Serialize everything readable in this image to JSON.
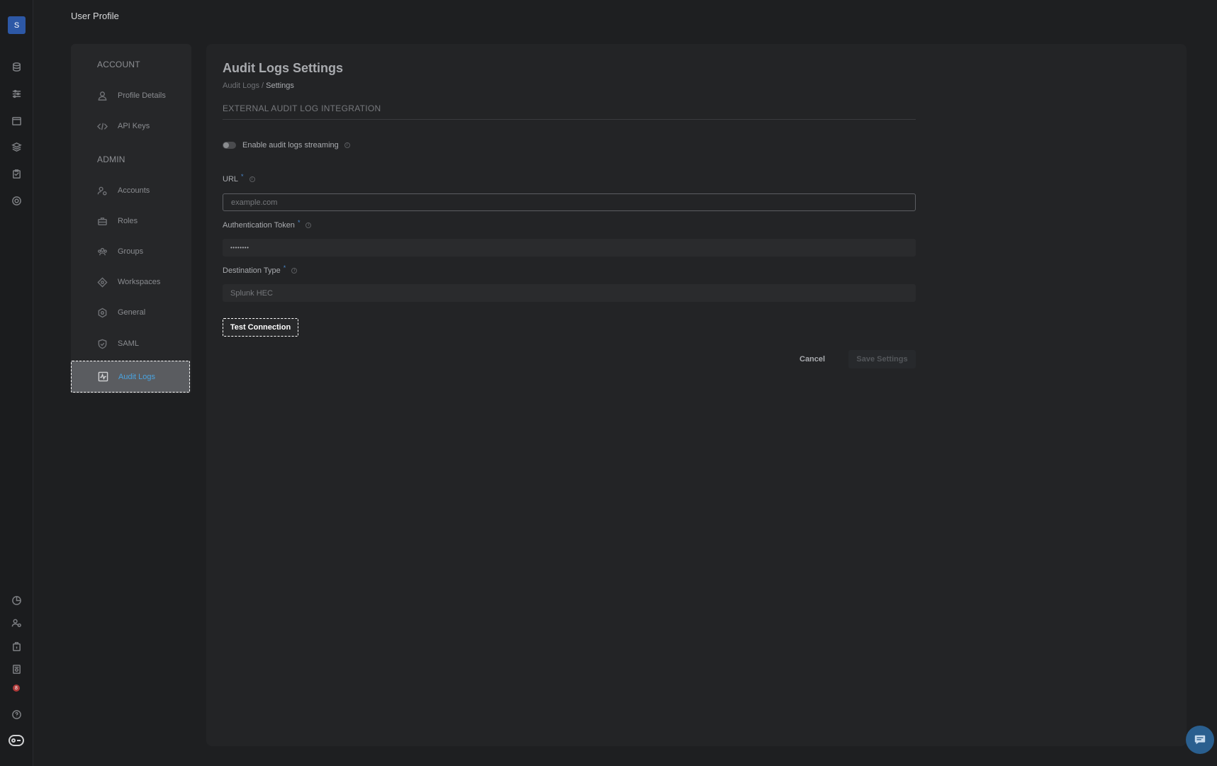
{
  "app": {
    "avatar_letter": "S",
    "page_title": "User Profile",
    "notification_count": "8"
  },
  "rail_icons": [
    "database-icon",
    "sliders-icon",
    "calendar-icon",
    "layers-icon",
    "clipboard-icon",
    "target-icon",
    "pie-chart-icon",
    "users-icon",
    "box-icon",
    "settings-list-icon",
    "notifications-icon",
    "help-icon",
    "toggle-icon"
  ],
  "sidebar": {
    "account_heading": "ACCOUNT",
    "admin_heading": "ADMIN",
    "items": [
      {
        "label": "Profile Details",
        "icon": "user-icon"
      },
      {
        "label": "API Keys",
        "icon": "code-icon"
      },
      {
        "label": "Accounts",
        "icon": "user-gear-icon"
      },
      {
        "label": "Roles",
        "icon": "briefcase-icon"
      },
      {
        "label": "Groups",
        "icon": "group-icon"
      },
      {
        "label": "Workspaces",
        "icon": "diamond-icon"
      },
      {
        "label": "General",
        "icon": "hex-gear-icon"
      },
      {
        "label": "SAML",
        "icon": "shield-icon"
      },
      {
        "label": "Audit Logs",
        "icon": "activity-icon",
        "active": true
      }
    ]
  },
  "main": {
    "title": "Audit Logs Settings",
    "breadcrumb": {
      "parent": "Audit Logs",
      "separator": " / ",
      "current": "Settings"
    },
    "section_heading": "EXTERNAL AUDIT LOG INTEGRATION",
    "streaming_toggle": {
      "label": "Enable audit logs streaming",
      "enabled": false
    },
    "url": {
      "label": "URL",
      "required_mark": "*",
      "placeholder": "example.com"
    },
    "token": {
      "label": "Authentication Token",
      "required_mark": "*",
      "value": "••••••••"
    },
    "destination": {
      "label": "Destination Type",
      "required_mark": "*",
      "value": "Splunk HEC"
    },
    "test_button": "Test Connection",
    "cancel_button": "Cancel",
    "save_button": "Save Settings"
  },
  "colors": {
    "accent": "#4aa3df",
    "required": "#4a86c9",
    "avatar_bg": "#2d58a6",
    "badge": "#b03a3a"
  }
}
